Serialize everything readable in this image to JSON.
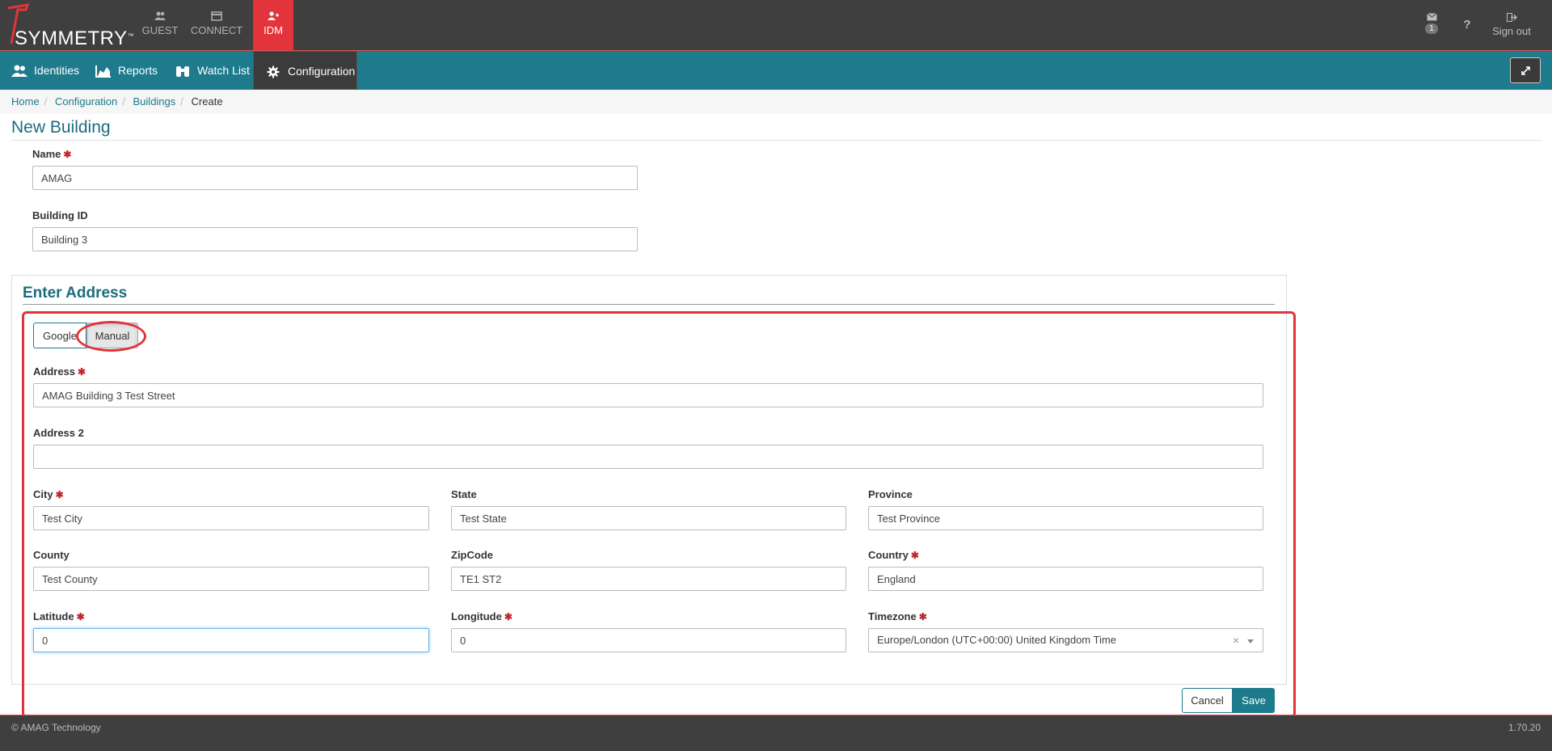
{
  "brand": {
    "name": "SYMMETRY",
    "tm": "™"
  },
  "apps": [
    {
      "label": "GUEST",
      "icon": "users-icon"
    },
    {
      "label": "CONNECT",
      "icon": "card-icon"
    },
    {
      "label": "IDM",
      "icon": "add-user-icon"
    }
  ],
  "topright": {
    "mail_count": "1",
    "help": "?",
    "signout": "Sign out"
  },
  "nav": [
    {
      "label": "Identities",
      "icon": "users-icon"
    },
    {
      "label": "Reports",
      "icon": "area-chart-icon"
    },
    {
      "label": "Watch List",
      "icon": "binoculars-icon"
    },
    {
      "label": "Configuration",
      "icon": "gear-icon"
    }
  ],
  "breadcrumb": [
    "Home",
    "Configuration",
    "Buildings",
    "Create"
  ],
  "page_title": "New Building",
  "form": {
    "name_label": "Name",
    "name_value": "AMAG",
    "building_id_label": "Building ID",
    "building_id_value": "Building 3"
  },
  "address": {
    "title": "Enter Address",
    "mode_google": "Google",
    "mode_manual": "Manual",
    "address_label": "Address",
    "address_value": "AMAG Building 3 Test Street",
    "address2_label": "Address 2",
    "address2_value": "",
    "city_label": "City",
    "city_value": "Test City",
    "state_label": "State",
    "state_value": "Test State",
    "province_label": "Province",
    "province_value": "Test Province",
    "county_label": "County",
    "county_value": "Test County",
    "zip_label": "ZipCode",
    "zip_value": "TE1 ST2",
    "country_label": "Country",
    "country_value": "England",
    "lat_label": "Latitude",
    "lat_value": "0",
    "lng_label": "Longitude",
    "lng_value": "0",
    "tz_label": "Timezone",
    "tz_value": "Europe/London (UTC+00:00) United Kingdom Time",
    "clear": "×"
  },
  "actions": {
    "cancel": "Cancel",
    "save": "Save"
  },
  "footer": {
    "copyright": "© AMAG Technology",
    "version": "1.70.20"
  },
  "colors": {
    "teal": "#1d7b8c",
    "red": "#e2343a",
    "dark": "#3f3f3f"
  }
}
